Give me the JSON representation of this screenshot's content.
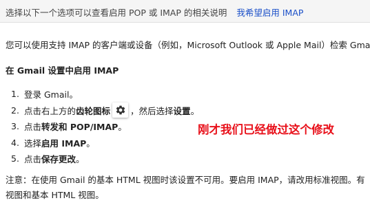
{
  "selector": {
    "prompt": "选择以下一个选项可以查看启用 POP 或 IMAP 的相关说明",
    "link": "我希望启用 IMAP"
  },
  "intro": "您可以使用支持 IMAP 的客户端或设备（例如，Microsoft Outlook 或 Apple Mail）检索 Gmail",
  "heading": "在 Gmail 设置中启用 IMAP",
  "steps": [
    {
      "num": "1.",
      "text": "登录 Gmail。"
    },
    {
      "num": "2.",
      "pre": "点击右上方的",
      "bold": "齿轮图标",
      "icon": "gear-icon",
      "mid": "，然后选择",
      "bold2": "设置",
      "post": "。"
    },
    {
      "num": "3.",
      "pre": "点击",
      "bold": "转发和 POP/IMAP",
      "post": "。"
    },
    {
      "num": "4.",
      "pre": "选择",
      "bold": "启用 IMAP",
      "post": "。"
    },
    {
      "num": "5.",
      "pre": "点击",
      "bold": "保存更改",
      "post": "。"
    }
  ],
  "annotation": "刚才我们已经做过这个修改",
  "note": {
    "line1": "注意：在使用 Gmail 的基本 HTML 视图时该设置不可用。要启用 IMAP，请改用标准视图。有",
    "line2": "视图和基本 HTML 视图。"
  },
  "colors": {
    "link": "#1a4fc8",
    "annotation": "#e8101a"
  }
}
